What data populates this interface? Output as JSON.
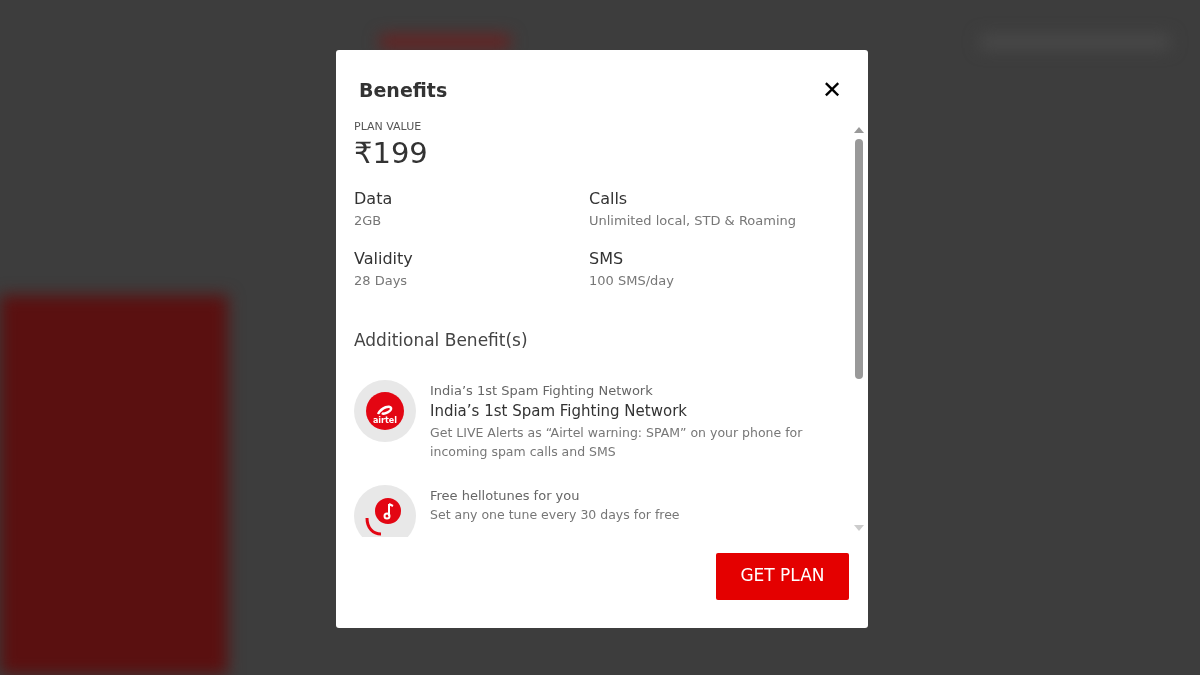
{
  "dialog": {
    "title": "Benefits",
    "close_symbol": "✕"
  },
  "plan": {
    "label": "PLAN VALUE",
    "value": "₹199"
  },
  "features": [
    {
      "name": "Data",
      "value": "2GB"
    },
    {
      "name": "Calls",
      "value": "Unlimited local, STD & Roaming"
    },
    {
      "name": "Validity",
      "value": "28 Days"
    },
    {
      "name": "SMS",
      "value": "100 SMS/day"
    }
  ],
  "additional_heading": "Additional Benefit(s)",
  "benefits": [
    {
      "kind": "logo",
      "logo_text": "airtel",
      "caption": "India’s 1st Spam Fighting Network",
      "title": "India’s 1st Spam Fighting Network",
      "description": "Get LIVE Alerts as “Airtel warning: SPAM” on your phone for incoming spam calls and SMS"
    },
    {
      "kind": "music",
      "caption": "Free hellotunes for you",
      "description": "Set any one tune every 30 days for free"
    }
  ],
  "button": "GET PLAN"
}
